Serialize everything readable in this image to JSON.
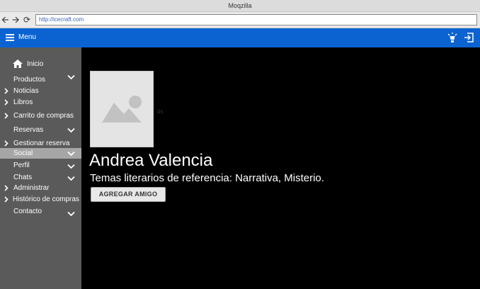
{
  "window": {
    "title": "Moqzilla"
  },
  "browser": {
    "url": "http://icecraft.com"
  },
  "appbar": {
    "menu_label": "Menu"
  },
  "sidebar": {
    "items": [
      {
        "label": "Inicio"
      },
      {
        "label": "Productos"
      },
      {
        "label": "Noticias"
      },
      {
        "label": "Libros"
      },
      {
        "label": "Carrito de compras"
      },
      {
        "label": "Reservas"
      },
      {
        "label": "Gestionar reserva"
      },
      {
        "label": "Social"
      },
      {
        "label": "Perfil"
      },
      {
        "label": "Chats"
      },
      {
        "label": "Administrar"
      },
      {
        "label": "Histórico de compras"
      },
      {
        "label": "Contacto"
      }
    ]
  },
  "profile": {
    "ghost_text": "ds",
    "name": "Andrea Valencia",
    "themes": "Temas literarios de referencia: Narrativa, Misterio.",
    "add_friend_label": "AGREGAR AMIGO"
  },
  "colors": {
    "accent": "#0b63d1",
    "sidebar": "#5a5a5a",
    "active_item": "#a6a6a6",
    "background": "#000000"
  }
}
